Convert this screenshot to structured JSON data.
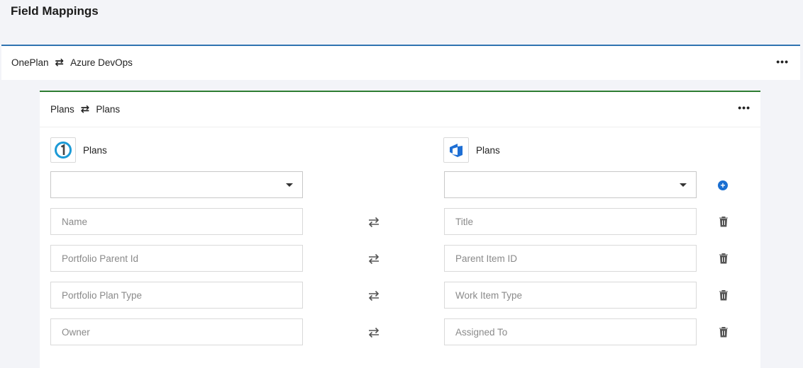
{
  "page": {
    "title": "Field Mappings"
  },
  "integration": {
    "source": "OnePlan",
    "target": "Azure DevOps",
    "more": "•••"
  },
  "mapping": {
    "source": "Plans",
    "target": "Plans",
    "more": "•••",
    "left_system": {
      "label": "Plans",
      "icon": "oneplan-logo-icon"
    },
    "right_system": {
      "label": "Plans",
      "icon": "azure-devops-logo-icon"
    },
    "add_label": "+",
    "rows": [
      {
        "left": "Name",
        "right": "Title"
      },
      {
        "left": "Portfolio Parent Id",
        "right": "Parent Item ID"
      },
      {
        "left": "Portfolio Plan Type",
        "right": "Work Item Type"
      },
      {
        "left": "Owner",
        "right": "Assigned To"
      }
    ]
  },
  "colors": {
    "outer_accent": "#2f73b0",
    "inner_accent": "#2e7d32",
    "add_button": "#1a6fd1"
  }
}
